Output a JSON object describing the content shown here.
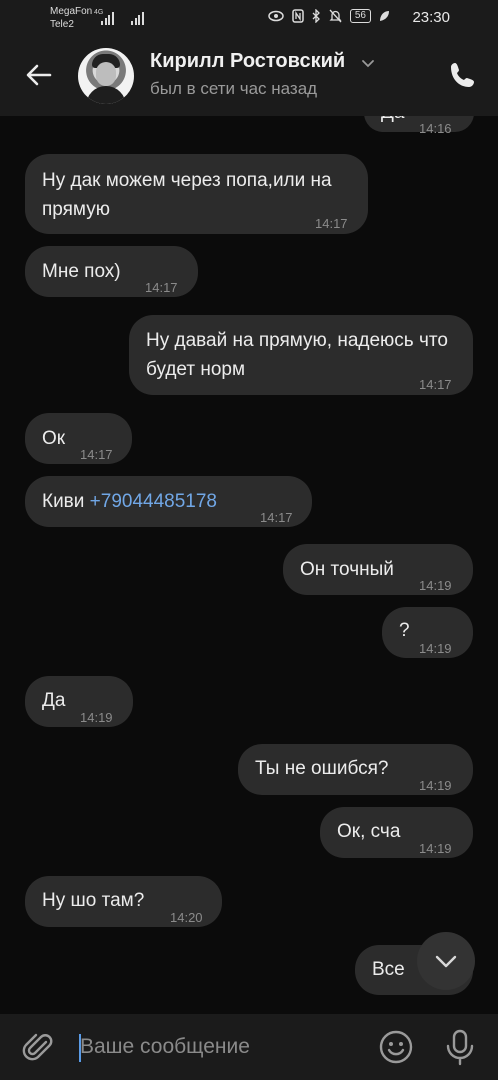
{
  "statusbar": {
    "carrier1": "MegaFon",
    "carrier2": "Tele2",
    "net_type": "4G",
    "battery": "56",
    "time": "23:30"
  },
  "header": {
    "name": "Кирилл Ростовский",
    "status": "был в сети час назад"
  },
  "messages": [
    {
      "text": "Да",
      "time": "14:16",
      "side": "out"
    },
    {
      "text": "Ну дак можем через попа,или на прямую",
      "time": "14:17",
      "side": "in"
    },
    {
      "text": "Мне пох)",
      "time": "14:17",
      "side": "in"
    },
    {
      "text": "Ну давай на прямую, надеюсь что будет норм",
      "time": "14:17",
      "side": "out"
    },
    {
      "text": "Ок",
      "time": "14:17",
      "side": "in"
    },
    {
      "text": "Киви",
      "link": "+79044485178",
      "time": "14:17",
      "side": "in"
    },
    {
      "text": "Он точный",
      "time": "14:19",
      "side": "out"
    },
    {
      "text": "?",
      "time": "14:19",
      "side": "out"
    },
    {
      "text": "Да",
      "time": "14:19",
      "side": "in"
    },
    {
      "text": "Ты не ошибся?",
      "time": "14:19",
      "side": "out"
    },
    {
      "text": "Ок, сча",
      "time": "14:19",
      "side": "out"
    },
    {
      "text": "Ну шо там?",
      "time": "14:20",
      "side": "in"
    },
    {
      "text": "Все",
      "time": "",
      "side": "out"
    }
  ],
  "input": {
    "placeholder": "Ваше сообщение",
    "value": ""
  },
  "colors": {
    "background": "#0b0b0b",
    "bubble": "#2c2c2c",
    "bar": "#1b1b1b",
    "link": "#71a7e6",
    "cursor": "#5a9be6"
  },
  "icons": {
    "back": "arrow-left-icon",
    "chevron": "chevron-down-icon",
    "call": "phone-icon",
    "scroll": "chevron-down-icon",
    "attach": "paperclip-icon",
    "emoji": "smiley-icon",
    "mic": "microphone-icon"
  }
}
